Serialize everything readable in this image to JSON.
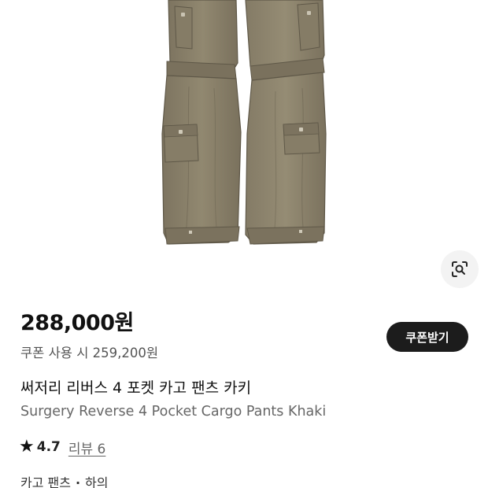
{
  "product": {
    "image_subject": "khaki cargo pants",
    "price": "288,000원",
    "coupon_price": "쿠폰 사용 시 259,200원",
    "coupon_button_label": "쿠폰받기",
    "title_ko": "써저리 리버스 4 포켓 카고 팬츠 카키",
    "title_en": "Surgery Reverse 4 Pocket Cargo Pants Khaki",
    "rating": "4.7",
    "review_label": "리뷰 6",
    "category": {
      "first": "카고 팬츠",
      "separator": "·",
      "second": "하의"
    }
  },
  "icons": {
    "lens": "lens-search-icon",
    "star": "star-icon"
  },
  "colors": {
    "pants_khaki": "#8a8068",
    "button_dark": "#1c1c1c"
  }
}
